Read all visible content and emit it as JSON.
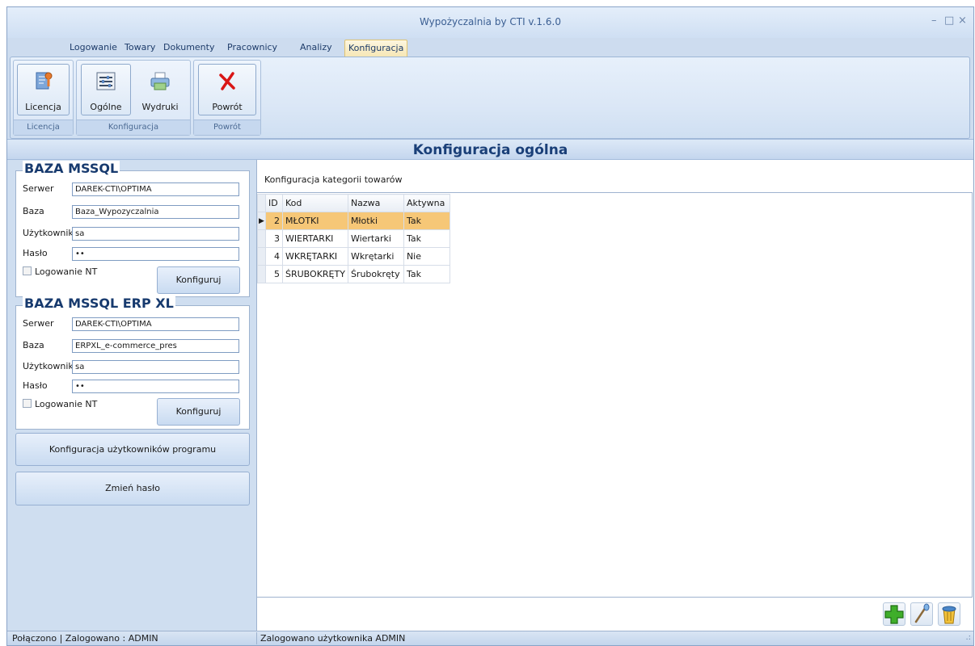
{
  "window": {
    "title": "Wypożyczalnia by CTI v.1.6.0",
    "controls": [
      "–",
      "□",
      "×"
    ]
  },
  "menu_tabs": [
    {
      "label": "Logowanie"
    },
    {
      "label": "Towary"
    },
    {
      "label": "Dokumenty"
    },
    {
      "label": "Pracownicy"
    },
    {
      "label": "Analizy"
    },
    {
      "label": "Konfiguracja",
      "active": true
    }
  ],
  "ribbon": {
    "groups": [
      {
        "label": "Licencja",
        "buttons": [
          {
            "label": "Licencja",
            "icon": "license-icon"
          }
        ]
      },
      {
        "label": "Konfiguracja",
        "buttons": [
          {
            "label": "Ogólne",
            "icon": "settings-sliders-icon"
          },
          {
            "label": "Wydruki",
            "icon": "printer-icon"
          }
        ]
      },
      {
        "label": "Powrót",
        "buttons": [
          {
            "label": "Powrót",
            "icon": "close-x-icon"
          }
        ]
      }
    ]
  },
  "section_title": "Konfiguracja ogólna",
  "db_mssql": {
    "title": "BAZA MSSQL",
    "server_label": "Serwer",
    "server_value": "DAREK-CTI\\OPTIMA",
    "db_label": "Baza",
    "db_value": "Baza_Wypozyczalnia",
    "user_label": "Użytkownik",
    "user_value": "sa",
    "password_label": "Hasło",
    "password_value": "••",
    "nt_login_label": "Logowanie NT",
    "configure_label": "Konfiguruj"
  },
  "db_erp": {
    "title": "BAZA MSSQL ERP XL",
    "server_label": "Serwer",
    "server_value": "DAREK-CTI\\OPTIMA",
    "db_label": "Baza",
    "db_value": "ERPXL_e-commerce_pres",
    "user_label": "Użytkownik",
    "user_value": "sa",
    "password_label": "Hasło",
    "password_value": "••",
    "nt_login_label": "Logowanie NT",
    "configure_label": "Konfiguruj"
  },
  "users_config_label": "Konfiguracja użytkowników programu",
  "change_password_label": "Zmień hasło",
  "categories": {
    "caption": "Konfiguracja kategorii towarów",
    "columns": [
      "ID",
      "Kod",
      "Nazwa",
      "Aktywna"
    ],
    "rows": [
      {
        "id": "2",
        "kod": "MŁOTKI",
        "nazwa": "Młotki",
        "aktywna": "Tak",
        "selected": true
      },
      {
        "id": "3",
        "kod": "WIERTARKI",
        "nazwa": "Wiertarki",
        "aktywna": "Tak"
      },
      {
        "id": "4",
        "kod": "WKRĘTARKI",
        "nazwa": "Wkrętarki",
        "aktywna": "Nie"
      },
      {
        "id": "5",
        "kod": "ŚRUBOKRĘTY",
        "nazwa": "Śrubokręty",
        "aktywna": "Tak"
      }
    ],
    "actions": [
      {
        "icon": "add-plus-icon"
      },
      {
        "icon": "edit-icon"
      },
      {
        "icon": "delete-trash-icon"
      }
    ]
  },
  "status": {
    "left": "Połączono | Zalogowano : ADMIN",
    "right": "Zalogowano użytkownika ADMIN"
  },
  "colors": {
    "selected_row": "#f6c777",
    "title_text": "#1a3f78",
    "active_tab": "#f6e7b6"
  }
}
